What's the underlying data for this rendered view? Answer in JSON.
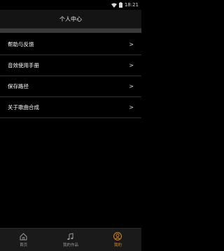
{
  "status_bar": {
    "time": "18:21"
  },
  "header": {
    "title": "个人中心"
  },
  "menu": {
    "items": [
      {
        "label": "帮助与反馈",
        "chevron": ">"
      },
      {
        "label": "音效使用手册",
        "chevron": ">"
      },
      {
        "label": "保存路径",
        "chevron": ">"
      },
      {
        "label": "关于歌曲合成",
        "chevron": ">"
      }
    ]
  },
  "tabs": [
    {
      "label": "首页",
      "icon": "home-icon",
      "active": false
    },
    {
      "label": "我的作品",
      "icon": "music-note-icon",
      "active": false
    },
    {
      "label": "我的",
      "icon": "user-icon",
      "active": true
    }
  ],
  "colors": {
    "accent": "#e08a1e",
    "background": "#000000"
  }
}
